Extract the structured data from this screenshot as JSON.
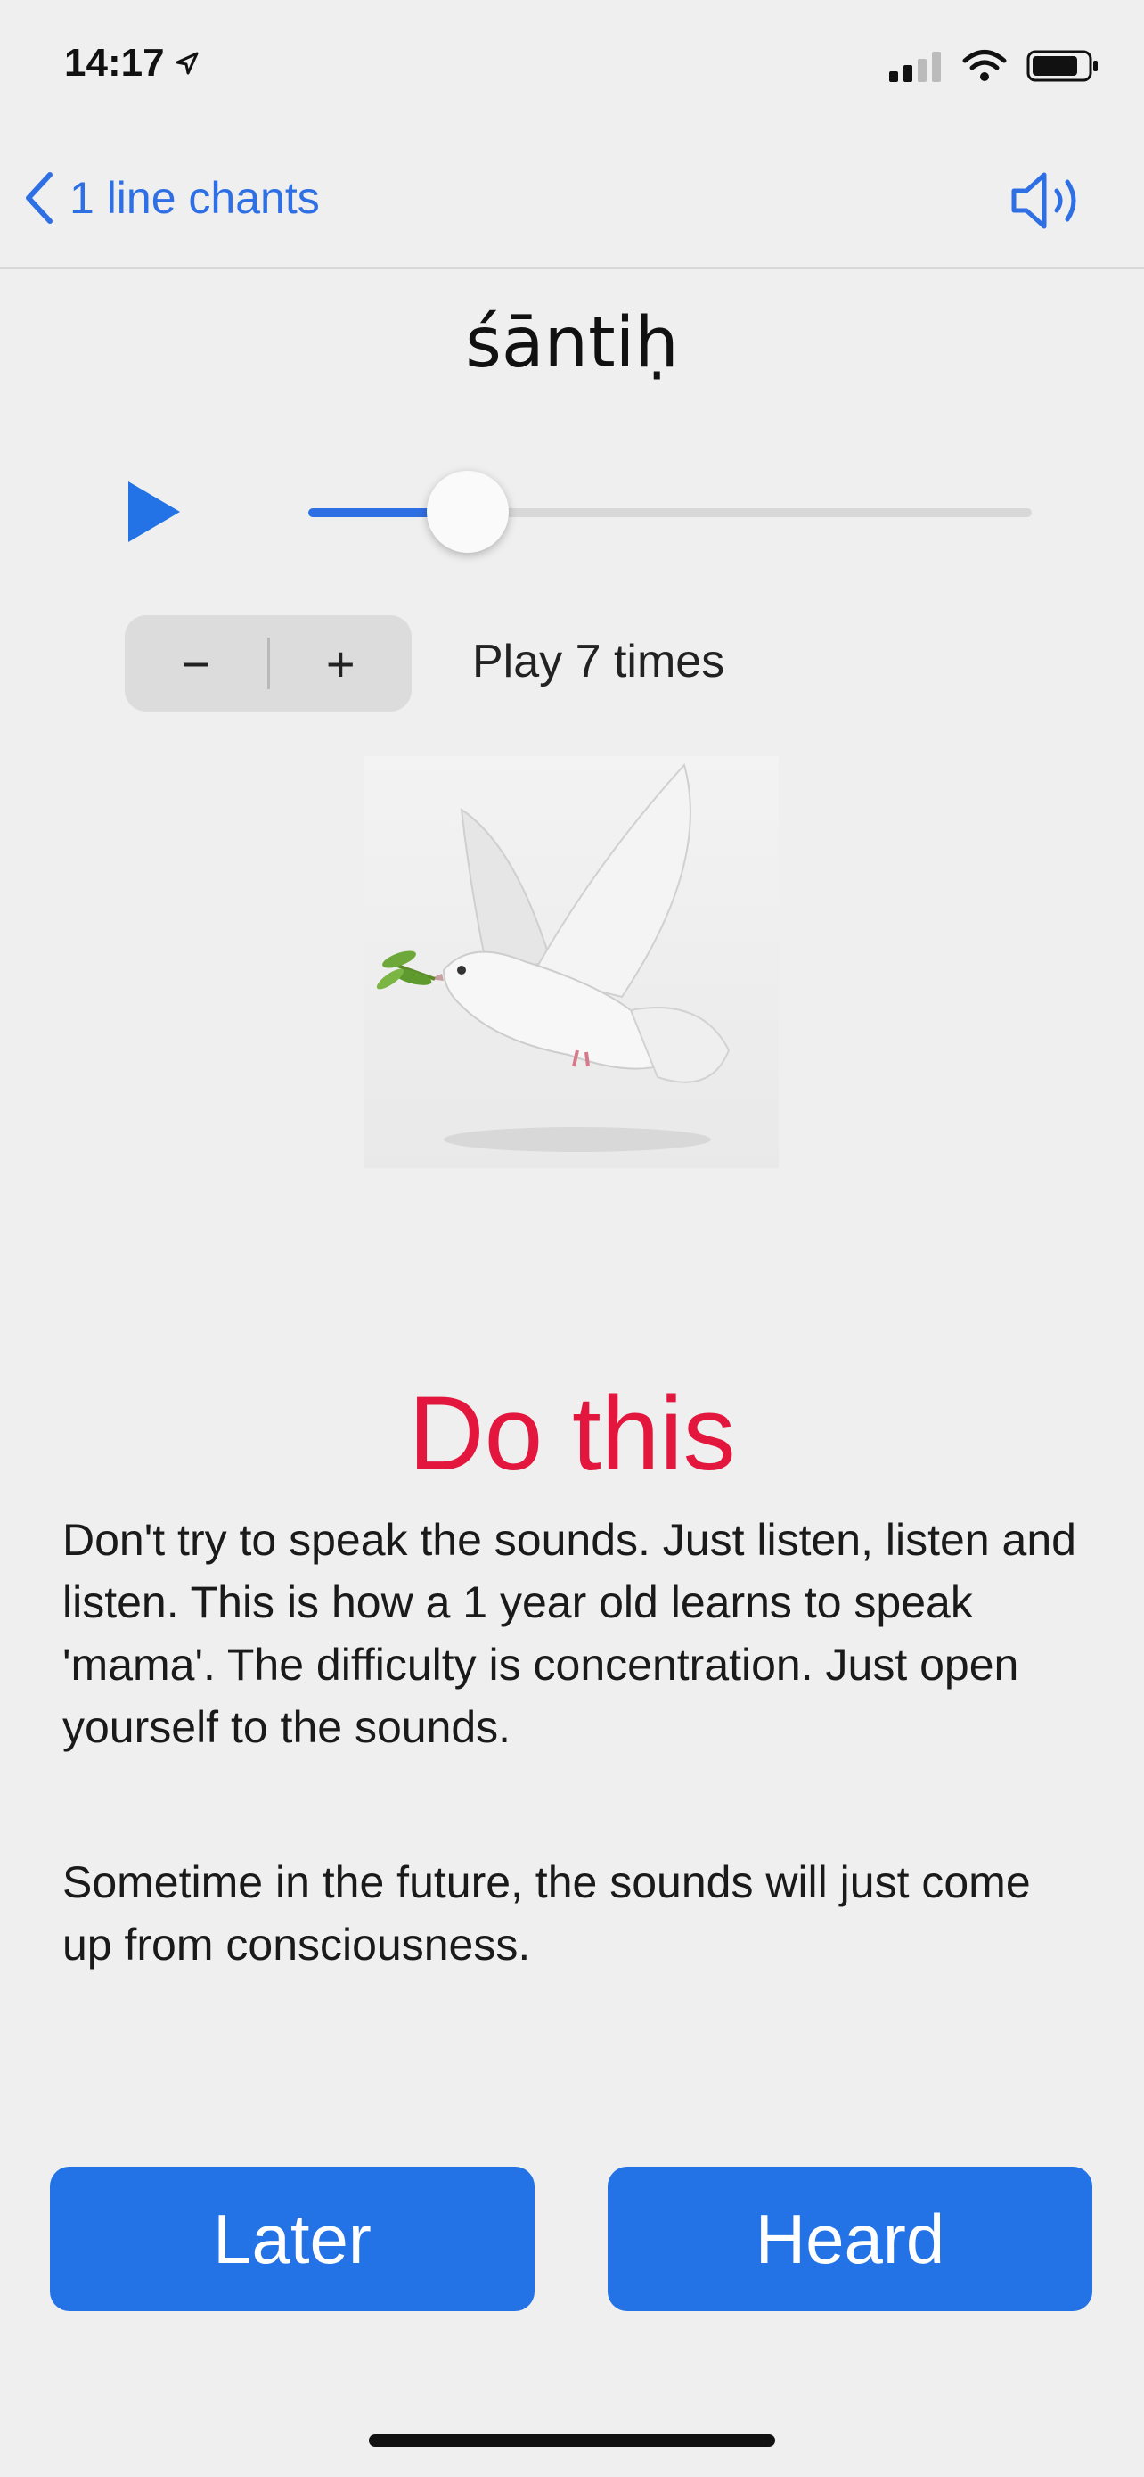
{
  "status_bar": {
    "time": "14:17"
  },
  "nav": {
    "back_label": "1 line chants",
    "back_icon": "chevron-left-icon",
    "sound_icon": "speaker-icon"
  },
  "chant": {
    "title": "śāntiḥ"
  },
  "player": {
    "progress": 0.22,
    "play_icon": "play-icon"
  },
  "repeat": {
    "minus_label": "−",
    "plus_label": "+",
    "text": "Play 7 times"
  },
  "instructions": {
    "heading": "Do this",
    "paragraph1": "Don't try to speak the sounds. Just listen, listen and listen. This is how a 1 year old learns to speak 'mama'. The difficulty is concentration. Just open yourself to the sounds.",
    "paragraph2": "Sometime in the future, the sounds will just come up from consciousness."
  },
  "actions": {
    "later_label": "Later",
    "heard_label": "Heard"
  },
  "colors": {
    "accent": "#2f6fe4",
    "button": "#2473e6",
    "heading": "#e3173e"
  }
}
